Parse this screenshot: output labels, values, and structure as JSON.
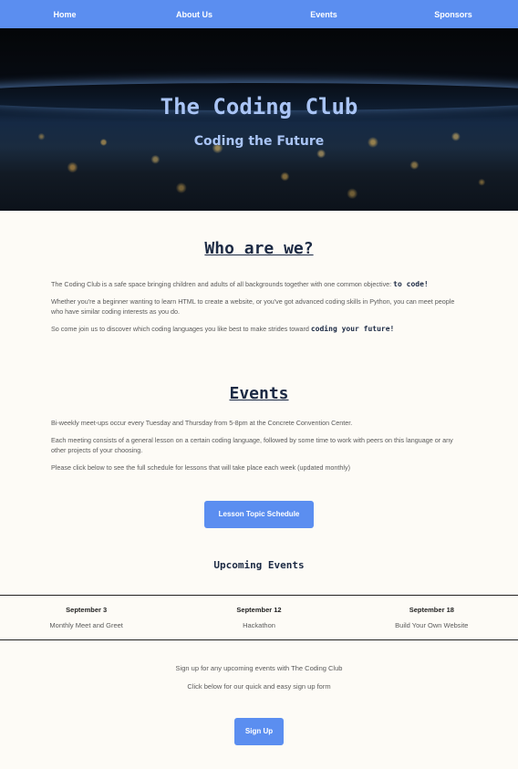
{
  "nav": {
    "items": [
      "Home",
      "About Us",
      "Events",
      "Sponsors"
    ]
  },
  "hero": {
    "title": "The Coding Club",
    "subtitle": "Coding the Future"
  },
  "about": {
    "heading": "Who are we?",
    "p1_text": "The Coding Club is a safe space bringing children and adults of all backgrounds together with one common objective: ",
    "p1_highlight": "to code!",
    "p2": "Whether you're a beginner wanting to learn HTML to create a website, or you've got advanced coding skills in Python, you can meet people who have similar coding interests as you do.",
    "p3_text": "So come join us to discover which coding languages you like best to make strides toward ",
    "p3_highlight": "coding your future!"
  },
  "events": {
    "heading": "Events",
    "p1": "Bi-weekly meet-ups occur every Tuesday and Thursday from 5-8pm at the Concrete Convention Center.",
    "p2": "Each meeting consists of a general lesson on a certain coding language, followed by some time to work with peers on this language or any other projects of your choosing.",
    "p3": "Please click below to see the full schedule for lessons that will take place each week (updated monthly)",
    "schedule_button": "Lesson Topic Schedule",
    "upcoming_heading": "Upcoming Events",
    "upcoming": [
      {
        "date": "September 3",
        "name": "Monthly Meet and Greet"
      },
      {
        "date": "September 12",
        "name": "Hackathon"
      },
      {
        "date": "September 18",
        "name": "Build Your Own Website"
      }
    ]
  },
  "signup": {
    "line1": "Sign up for any upcoming events with The Coding Club",
    "line2": "Click below for our quick and easy sign up form",
    "button": "Sign Up"
  }
}
